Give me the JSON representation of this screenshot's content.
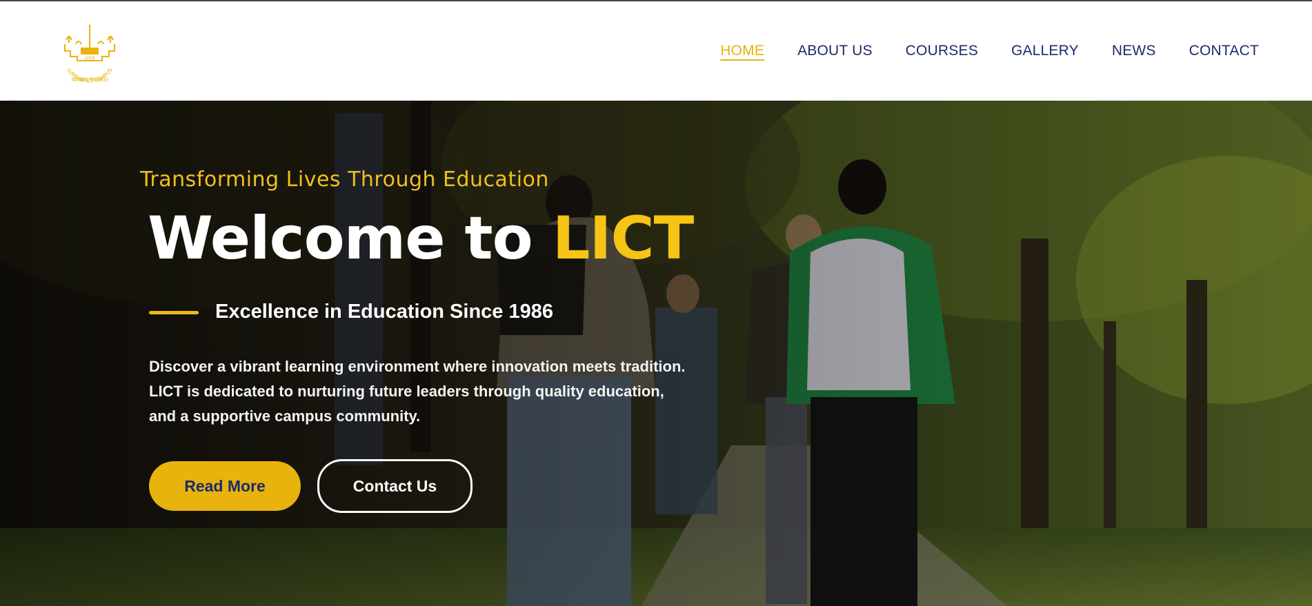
{
  "logo": {
    "ring_text": "LUMBINI ICT CAMPUS",
    "bottom_text": "NAWALPARASI",
    "year": "2069",
    "color": "#e8b30c"
  },
  "nav": {
    "items": [
      {
        "label": "HOME",
        "active": true
      },
      {
        "label": "ABOUT US"
      },
      {
        "label": "COURSES"
      },
      {
        "label": "GALLERY"
      },
      {
        "label": "NEWS"
      },
      {
        "label": "CONTACT"
      }
    ],
    "active_color": "#e8b30c",
    "color": "#1d2a6b"
  },
  "hero": {
    "tagline": "Transforming Lives Through Education",
    "headline_prefix": "Welcome to ",
    "headline_accent": "LICT",
    "subheading": "Excellence in Education Since 1986",
    "description_lines": [
      "Discover a vibrant learning environment where innovation meets tradition.",
      "LICT is dedicated to nurturing future leaders through quality education,",
      "and a supportive campus community."
    ],
    "primary_button": "Read More",
    "secondary_button": "Contact Us",
    "accent_color": "#f5c414"
  }
}
